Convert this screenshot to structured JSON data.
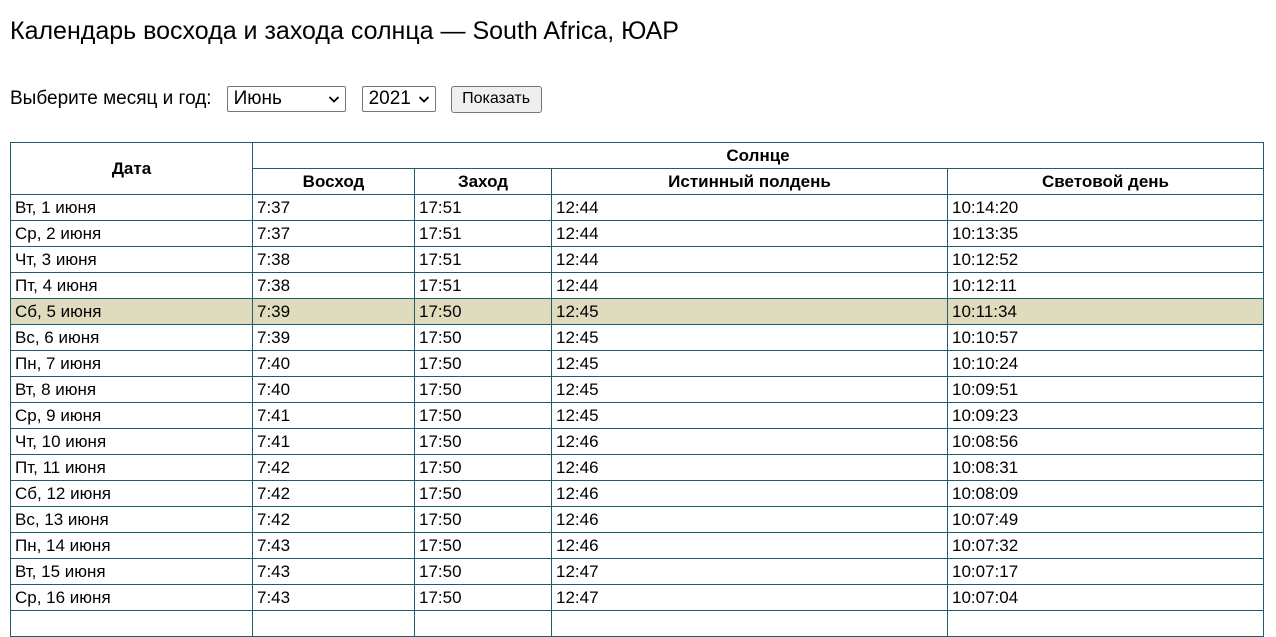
{
  "page": {
    "title": "Календарь восхода и захода солнца — South Africa, ЮАР"
  },
  "controls": {
    "label": "Выберите месяц и год:",
    "month": "Июнь",
    "year": "2021",
    "show_button": "Показать"
  },
  "table": {
    "col_date": "Дата",
    "group_sun": "Солнце",
    "col_sunrise": "Восход",
    "col_sunset": "Заход",
    "col_noon": "Истинный полдень",
    "col_daylength": "Световой день",
    "rows": [
      {
        "date": "Вт, 1 июня",
        "sunrise": "7:37",
        "sunset": "17:51",
        "noon": "12:44",
        "length": "10:14:20",
        "highlight": false
      },
      {
        "date": "Ср, 2 июня",
        "sunrise": "7:37",
        "sunset": "17:51",
        "noon": "12:44",
        "length": "10:13:35",
        "highlight": false
      },
      {
        "date": "Чт, 3 июня",
        "sunrise": "7:38",
        "sunset": "17:51",
        "noon": "12:44",
        "length": "10:12:52",
        "highlight": false
      },
      {
        "date": "Пт, 4 июня",
        "sunrise": "7:38",
        "sunset": "17:51",
        "noon": "12:44",
        "length": "10:12:11",
        "highlight": false
      },
      {
        "date": "Сб, 5 июня",
        "sunrise": "7:39",
        "sunset": "17:50",
        "noon": "12:45",
        "length": "10:11:34",
        "highlight": true
      },
      {
        "date": "Вс, 6 июня",
        "sunrise": "7:39",
        "sunset": "17:50",
        "noon": "12:45",
        "length": "10:10:57",
        "highlight": false
      },
      {
        "date": "Пн, 7 июня",
        "sunrise": "7:40",
        "sunset": "17:50",
        "noon": "12:45",
        "length": "10:10:24",
        "highlight": false
      },
      {
        "date": "Вт, 8 июня",
        "sunrise": "7:40",
        "sunset": "17:50",
        "noon": "12:45",
        "length": "10:09:51",
        "highlight": false
      },
      {
        "date": "Ср, 9 июня",
        "sunrise": "7:41",
        "sunset": "17:50",
        "noon": "12:45",
        "length": "10:09:23",
        "highlight": false
      },
      {
        "date": "Чт, 10 июня",
        "sunrise": "7:41",
        "sunset": "17:50",
        "noon": "12:46",
        "length": "10:08:56",
        "highlight": false
      },
      {
        "date": "Пт, 11 июня",
        "sunrise": "7:42",
        "sunset": "17:50",
        "noon": "12:46",
        "length": "10:08:31",
        "highlight": false
      },
      {
        "date": "Сб, 12 июня",
        "sunrise": "7:42",
        "sunset": "17:50",
        "noon": "12:46",
        "length": "10:08:09",
        "highlight": false
      },
      {
        "date": "Вс, 13 июня",
        "sunrise": "7:42",
        "sunset": "17:50",
        "noon": "12:46",
        "length": "10:07:49",
        "highlight": false
      },
      {
        "date": "Пн, 14 июня",
        "sunrise": "7:43",
        "sunset": "17:50",
        "noon": "12:46",
        "length": "10:07:32",
        "highlight": false
      },
      {
        "date": "Вт, 15 июня",
        "sunrise": "7:43",
        "sunset": "17:50",
        "noon": "12:47",
        "length": "10:07:17",
        "highlight": false
      },
      {
        "date": "Ср, 16 июня",
        "sunrise": "7:43",
        "sunset": "17:50",
        "noon": "12:47",
        "length": "10:07:04",
        "highlight": false
      },
      {
        "date": "",
        "sunrise": "",
        "sunset": "",
        "noon": "",
        "length": "",
        "highlight": false
      }
    ]
  },
  "colors": {
    "border": "#1f5d6b",
    "highlight_row": "#dedcbd"
  },
  "icons": {
    "select_arrow": "chevron-down-icon"
  }
}
